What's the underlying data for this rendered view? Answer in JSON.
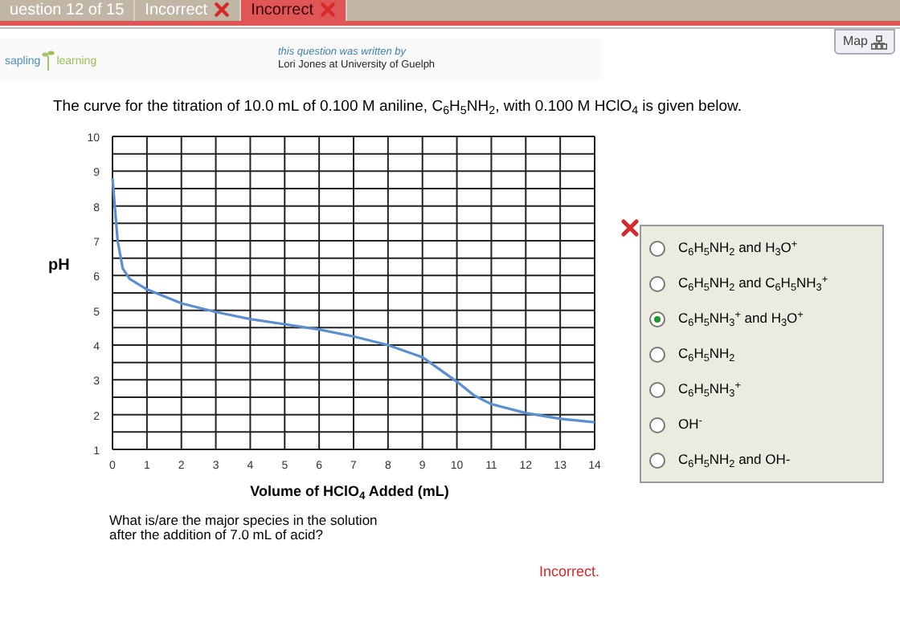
{
  "tabs": [
    {
      "label": "uestion 12 of 15",
      "selected": false,
      "incorrect": false
    },
    {
      "label": "Incorrect",
      "selected": false,
      "incorrect": true
    },
    {
      "label": "Incorrect",
      "selected": true,
      "incorrect": true
    }
  ],
  "header": {
    "logo_left": "sapling",
    "logo_right": "learning",
    "credit_line": "this question was written by",
    "author": "Lori Jones at University of Guelph",
    "map_button": "Map"
  },
  "question_intro": "The curve for the titration of 10.0 mL of 0.100 M aniline, C$_{6}$H$_{5}$NH$_{2}$, with 0.100 M HClO$_{4}$ is given below.",
  "chart": {
    "chart_data": {
      "type": "line",
      "grid": true,
      "xlabel": "Volume of HClO$_{4}$ Added (mL)",
      "ylabel": "pH",
      "xlim": [
        0,
        14
      ],
      "ylim": [
        1,
        10
      ],
      "xticks": [
        0,
        1,
        2,
        3,
        4,
        5,
        6,
        7,
        8,
        9,
        10,
        11,
        12,
        13,
        14
      ],
      "yticks": [
        1,
        2,
        3,
        4,
        5,
        6,
        7,
        8,
        9,
        10
      ],
      "x": [
        0,
        0.15,
        0.3,
        0.5,
        1,
        2,
        3,
        4,
        5,
        6,
        7,
        8,
        9,
        9.5,
        10,
        10.5,
        11,
        12,
        13,
        14
      ],
      "series": [
        {
          "color": "#5b8fd0",
          "values": [
            8.8,
            7.0,
            6.2,
            5.9,
            5.6,
            5.2,
            4.95,
            4.75,
            4.6,
            4.45,
            4.25,
            4.0,
            3.65,
            3.3,
            2.95,
            2.55,
            2.3,
            2.05,
            1.88,
            1.78
          ]
        }
      ]
    }
  },
  "prompt": "What is/are the major species in the solution after the addition of 7.0 mL of acid?",
  "feedback": "Incorrect.",
  "answer_marked_incorrect": true,
  "options": [
    {
      "label": "C$_{6}$H$_{5}$NH$_{2}$ and H$_{3}$O$^{+}$",
      "selected": false
    },
    {
      "label": "C$_{6}$H$_{5}$NH$_{2}$ and C$_{6}$H$_{5}$NH$_{3}$$^{+}$",
      "selected": false
    },
    {
      "label": "C$_{6}$H$_{5}$NH$_{3}$$^{+}$ and H$_{3}$O$^{+}$",
      "selected": true
    },
    {
      "label": "C$_{6}$H$_{5}$NH$_{2}$",
      "selected": false
    },
    {
      "label": "C$_{6}$H$_{5}$NH$_{3}$$^{+}$",
      "selected": false
    },
    {
      "label": "OH$^{-}$",
      "selected": false
    },
    {
      "label": "C$_{6}$H$_{5}$NH$_{2}$ and OH-",
      "selected": false
    }
  ]
}
